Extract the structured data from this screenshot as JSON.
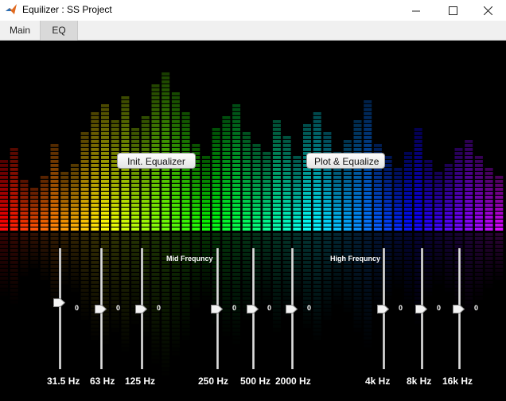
{
  "window": {
    "title": "Equilizer : SS Project",
    "icon": "matlab-logo-icon",
    "controls": [
      "minimize-icon",
      "maximize-icon",
      "close-icon"
    ]
  },
  "tabs": [
    {
      "label": "Main",
      "selected": false
    },
    {
      "label": "EQ",
      "selected": true
    }
  ],
  "buttons": {
    "init": "Init. Equalizer",
    "plot": "Plot & Equalize"
  },
  "groups": {
    "mid": "Mid Frequncy",
    "high": "High Frequncy"
  },
  "bands": [
    {
      "label": "31.5 Hz",
      "value": "0",
      "level": 0
    },
    {
      "label": "63 Hz",
      "value": "0",
      "level": 0
    },
    {
      "label": "125 Hz",
      "value": "0",
      "level": 0
    },
    {
      "label": "250 Hz",
      "value": "0",
      "level": 0
    },
    {
      "label": "500 Hz",
      "value": "0",
      "level": 0
    },
    {
      "label": "2000 Hz",
      "value": "0",
      "level": 0
    },
    {
      "label": "4k Hz",
      "value": "0",
      "level": 0
    },
    {
      "label": "8k Hz",
      "value": "0",
      "level": 0
    },
    {
      "label": "16k Hz",
      "value": "0",
      "level": 0
    }
  ],
  "background": "colorful spectrum bars"
}
